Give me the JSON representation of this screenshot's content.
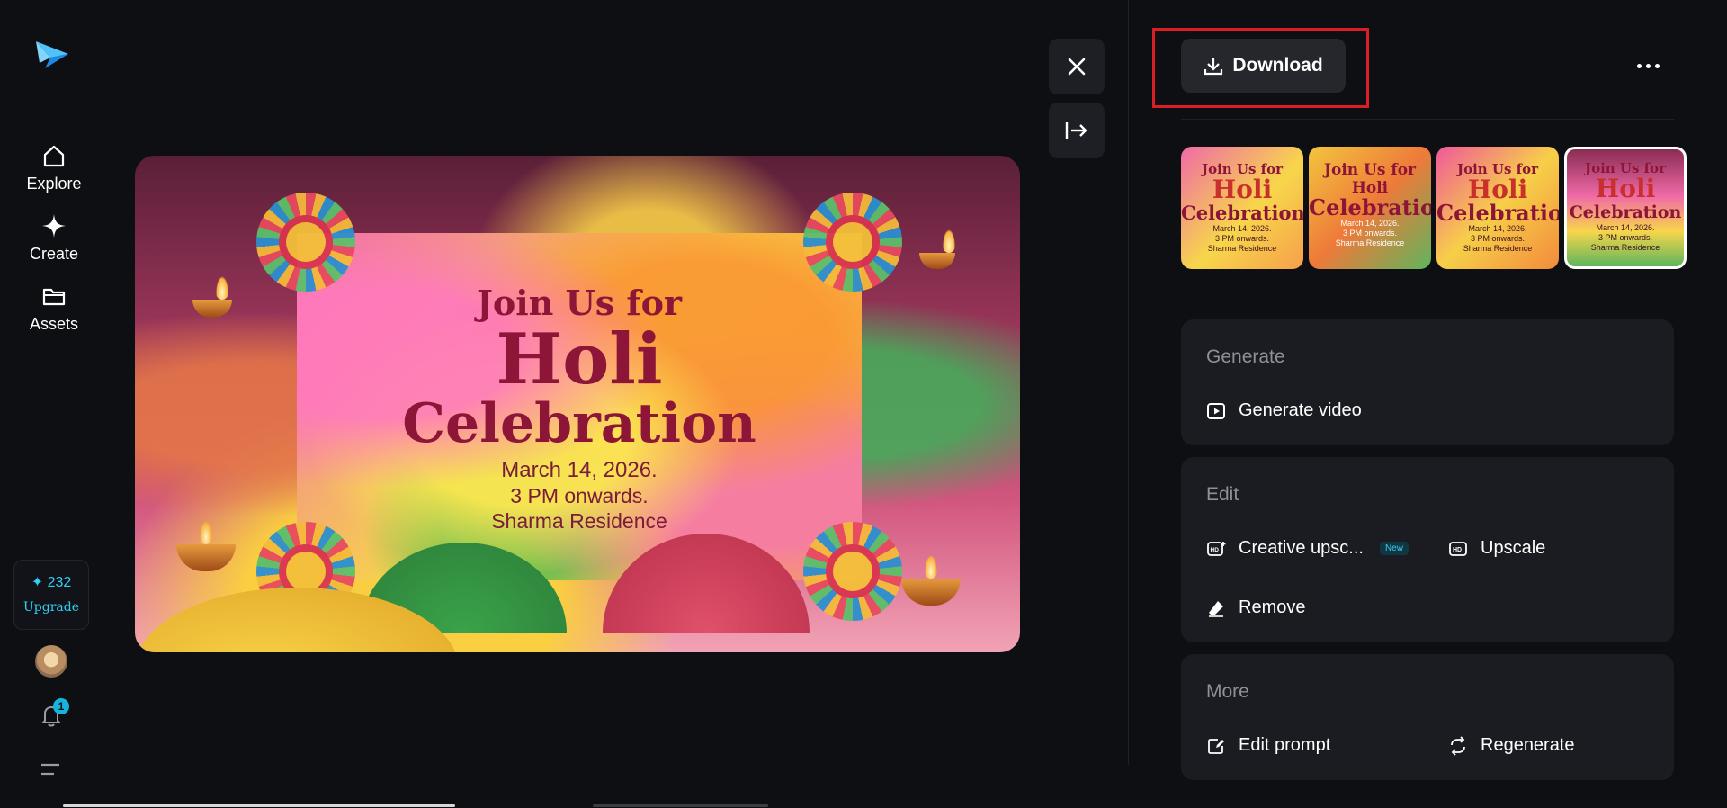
{
  "sidebar": {
    "items": [
      {
        "label": "Explore",
        "icon": "home-icon"
      },
      {
        "label": "Create",
        "icon": "sparkle-icon"
      },
      {
        "label": "Assets",
        "icon": "folder-icon"
      }
    ],
    "credits": {
      "count": "✦ 232",
      "upgrade_label": "Upgrade"
    },
    "notification_count": "1"
  },
  "poster": {
    "line1": "Join Us for",
    "line2": "Holi",
    "line3": "Celebration",
    "date": "March 14, 2026.",
    "time": "3 PM onwards.",
    "place": "Sharma Residence"
  },
  "toolbar": {
    "download_label": "Download",
    "close_icon": "close-icon",
    "collapse_icon": "collapse-panel-icon",
    "more_icon": "more-icon"
  },
  "thumbnails": [
    {
      "line1": "Join Us for",
      "line2": "Holi",
      "line3": "Celebration",
      "l4": "March 14, 2026.",
      "l5": "3 PM onwards.",
      "l6": "Sharma Residence",
      "selected": false
    },
    {
      "line1": "Join Us for Holi",
      "line2": "",
      "line3": "Celebration",
      "l4": "March 14, 2026.",
      "l5": "3 PM onwards.",
      "l6": "Sharma Residence",
      "selected": false
    },
    {
      "line1": "Join Us for",
      "line2": "Holi",
      "line3": "Celebration",
      "l4": "March 14, 2026.",
      "l5": "3 PM onwards.",
      "l6": "Sharma Residence",
      "selected": false
    },
    {
      "line1": "Join Us for",
      "line2": "Holi",
      "line3": "Celebration",
      "l4": "March 14, 2026.",
      "l5": "3 PM onwards.",
      "l6": "Sharma Residence",
      "selected": true
    }
  ],
  "panels": {
    "generate": {
      "title": "Generate",
      "actions": [
        {
          "label": "Generate video",
          "icon": "play-video-icon"
        }
      ]
    },
    "edit": {
      "title": "Edit",
      "actions": [
        {
          "label": "Creative upsc...",
          "icon": "hd-plus-icon",
          "badge": "New"
        },
        {
          "label": "Upscale",
          "icon": "hd-icon"
        },
        {
          "label": "Remove",
          "icon": "eraser-icon"
        }
      ]
    },
    "more": {
      "title": "More",
      "actions": [
        {
          "label": "Edit prompt",
          "icon": "edit-prompt-icon"
        },
        {
          "label": "Regenerate",
          "icon": "regenerate-icon"
        }
      ]
    }
  },
  "colors": {
    "background": "#0e0f12",
    "panel": "#1b1c21",
    "accent": "#2fd0f4",
    "highlight": "#d91e24"
  }
}
